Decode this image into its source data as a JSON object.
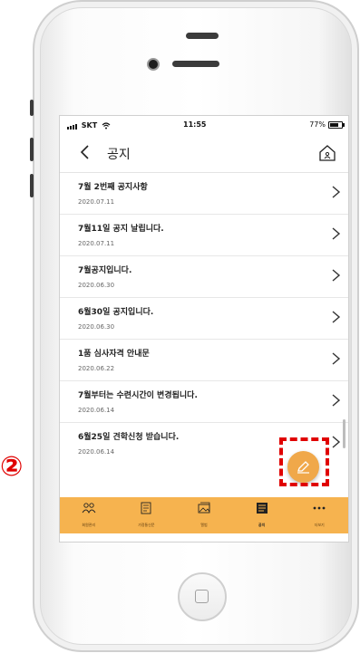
{
  "status_bar": {
    "carrier": "SKT",
    "time": "11:55",
    "battery": "77%"
  },
  "header": {
    "title": "공지"
  },
  "notices": [
    {
      "title": "7월 2번째 공지사항",
      "date": "2020.07.11"
    },
    {
      "title": "7월11일 공지 날립니다.",
      "date": "2020.07.11"
    },
    {
      "title": "7월공지입니다.",
      "date": "2020.06.30"
    },
    {
      "title": "6월30일 공지입니다.",
      "date": "2020.06.30"
    },
    {
      "title": "1품 심사자격 안내문",
      "date": "2020.06.22"
    },
    {
      "title": "7월부터는 수련시간이 변경됩니다.",
      "date": "2020.06.14"
    },
    {
      "title": "6월25일 견학신청 받습니다.",
      "date": "2020.06.14"
    }
  ],
  "tabs": [
    {
      "label": "회원관리",
      "icon": "people-icon"
    },
    {
      "label": "가정통신문",
      "icon": "document-icon"
    },
    {
      "label": "앨범",
      "icon": "album-icon"
    },
    {
      "label": "공지",
      "icon": "notice-icon",
      "active": true
    },
    {
      "label": "더보기",
      "icon": "more-icon"
    }
  ],
  "annotation": {
    "step_marker": "②"
  },
  "colors": {
    "accent": "#f6b34f",
    "fab": "#f0a84a",
    "annotation": "#e00000"
  }
}
